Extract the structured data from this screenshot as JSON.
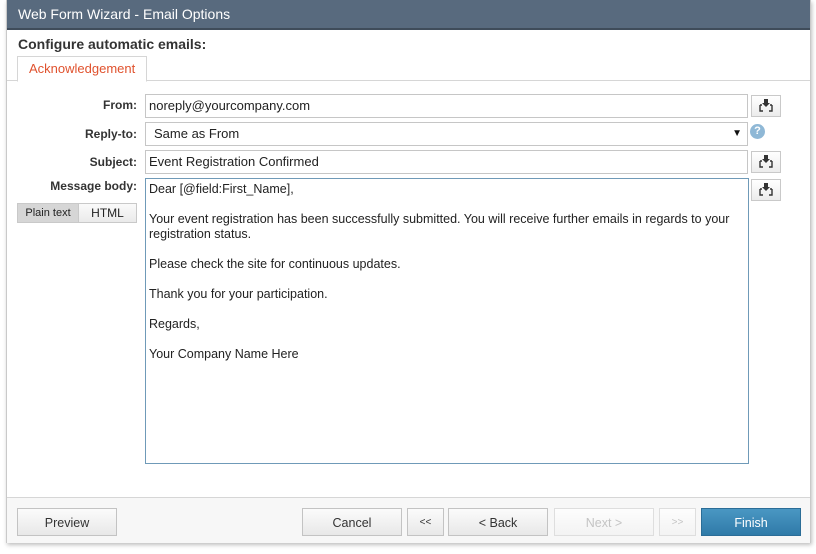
{
  "window": {
    "title": "Web Form Wizard - Email Options"
  },
  "section_title": "Configure automatic emails:",
  "tabs": [
    {
      "label": "Acknowledgement",
      "active": true
    }
  ],
  "form": {
    "from": {
      "label": "From:",
      "value": "noreply@yourcompany.com",
      "insert_icon": "insert-field-icon"
    },
    "reply_to": {
      "label": "Reply-to:",
      "value": "Same as From",
      "help_icon": "help-icon",
      "help_glyph": "?"
    },
    "subject": {
      "label": "Subject:",
      "value": "Event Registration Confirmed",
      "insert_icon": "insert-field-icon"
    },
    "message_body": {
      "label": "Message body:",
      "modes": [
        {
          "label": "Plain text",
          "active": true
        },
        {
          "label": "HTML",
          "active": false
        }
      ],
      "paragraphs": [
        "Dear [@field:First_Name],",
        "Your event registration has been successfully submitted. You will receive further emails in regards to your registration status.",
        "Please check the site for continuous updates.",
        "Thank you for your participation.",
        "Regards,",
        "Your Company Name Here"
      ]
    }
  },
  "footer": {
    "preview": "Preview",
    "cancel": "Cancel",
    "first": "<<",
    "back": "< Back",
    "next": "Next >",
    "last": ">>",
    "finish": "Finish"
  },
  "colors": {
    "titlebar": "#586a7e",
    "tab_active_text": "#e0522e",
    "primary_button": "#3a87b6",
    "help_icon": "#8fb8d6"
  }
}
